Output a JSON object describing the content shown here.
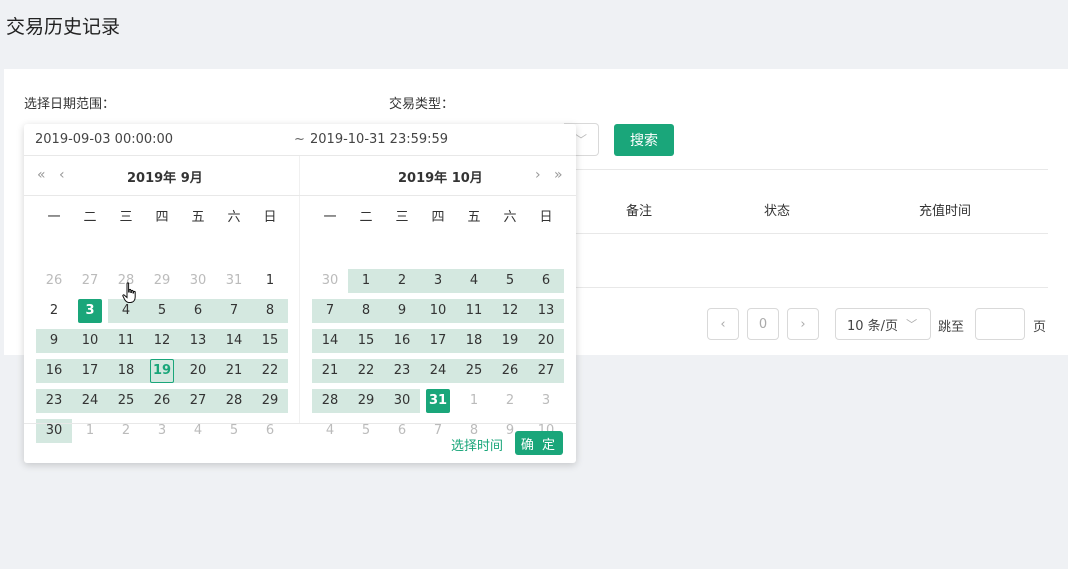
{
  "page": {
    "title": "交易历史记录"
  },
  "filters": {
    "date_label": "选择日期范围：",
    "type_label": "交易类型：",
    "start_value": "2019-09-03 00:00:00",
    "range_separator": "~",
    "end_value": "2019-10-31 23:59:59",
    "search_label": "搜索"
  },
  "table": {
    "headers": [
      "备注",
      "状态",
      "充值时间"
    ]
  },
  "pagination": {
    "prev_icon": "‹",
    "current": "0",
    "next_icon": "›",
    "page_size": "10 条/页",
    "jump_label": "跳至",
    "page_label": "页"
  },
  "picker": {
    "weekdays": [
      "一",
      "二",
      "三",
      "四",
      "五",
      "六",
      "日"
    ],
    "left": {
      "title": "2019年 9月",
      "prev_year_icon": "«",
      "prev_month_icon": "‹",
      "days": [
        [
          "26",
          "27",
          "28",
          "29",
          "30",
          "31",
          "1"
        ],
        [
          "2",
          "3",
          "4",
          "5",
          "6",
          "7",
          "8"
        ],
        [
          "9",
          "10",
          "11",
          "12",
          "13",
          "14",
          "15"
        ],
        [
          "16",
          "17",
          "18",
          "19",
          "20",
          "21",
          "22"
        ],
        [
          "23",
          "24",
          "25",
          "26",
          "27",
          "28",
          "29"
        ],
        [
          "30",
          "1",
          "2",
          "3",
          "4",
          "5",
          "6"
        ]
      ]
    },
    "right": {
      "title": "2019年 10月",
      "next_month_icon": "›",
      "next_year_icon": "»",
      "days": [
        [
          "30",
          "1",
          "2",
          "3",
          "4",
          "5",
          "6"
        ],
        [
          "7",
          "8",
          "9",
          "10",
          "11",
          "12",
          "13"
        ],
        [
          "14",
          "15",
          "16",
          "17",
          "18",
          "19",
          "20"
        ],
        [
          "21",
          "22",
          "23",
          "24",
          "25",
          "26",
          "27"
        ],
        [
          "28",
          "29",
          "30",
          "31",
          "1",
          "2",
          "3"
        ],
        [
          "4",
          "5",
          "6",
          "7",
          "8",
          "9",
          "10"
        ]
      ]
    },
    "select_time_label": "选择时间",
    "ok_label": "确 定"
  },
  "colors": {
    "accent": "#1aa67a",
    "range": "#d4e8e0"
  }
}
